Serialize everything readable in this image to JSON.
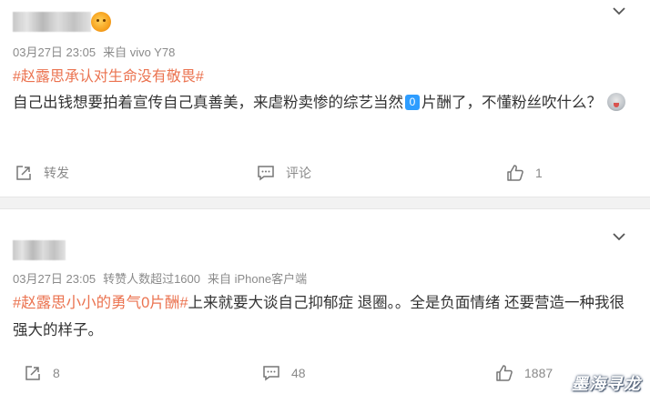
{
  "posts": [
    {
      "date": "03月27日 23:05",
      "source": "来自 vivo Y78",
      "topic": "#赵露思承认对生命没有敬畏#",
      "text_part1": "自己出钱想要拍着宣传自己真善美，来虐粉卖惨的综艺当然",
      "zero_badge": "0",
      "text_part2": "片酬了，不懂粉丝吹什么？",
      "actions": {
        "repost_label": "转发",
        "comment_label": "评论",
        "like_count": "1"
      }
    },
    {
      "date": "03月27日 23:05",
      "repost_info": "转赞人数超过1600",
      "source": "来自 iPhone客户端",
      "topic": "#赵露思小小的勇气0片酬#",
      "text": "上来就要大谈自己抑郁症 退圈。。全是负面情绪 还要营造一种我很强大的样子。",
      "actions": {
        "repost_count": "8",
        "comment_count": "48",
        "like_count": "1887"
      }
    }
  ],
  "watermark": "墨海寻龙",
  "icons": [
    "chevron-down-icon",
    "repost-icon",
    "comment-icon",
    "like-icon",
    "emoji-icon",
    "user-badge-icon"
  ]
}
